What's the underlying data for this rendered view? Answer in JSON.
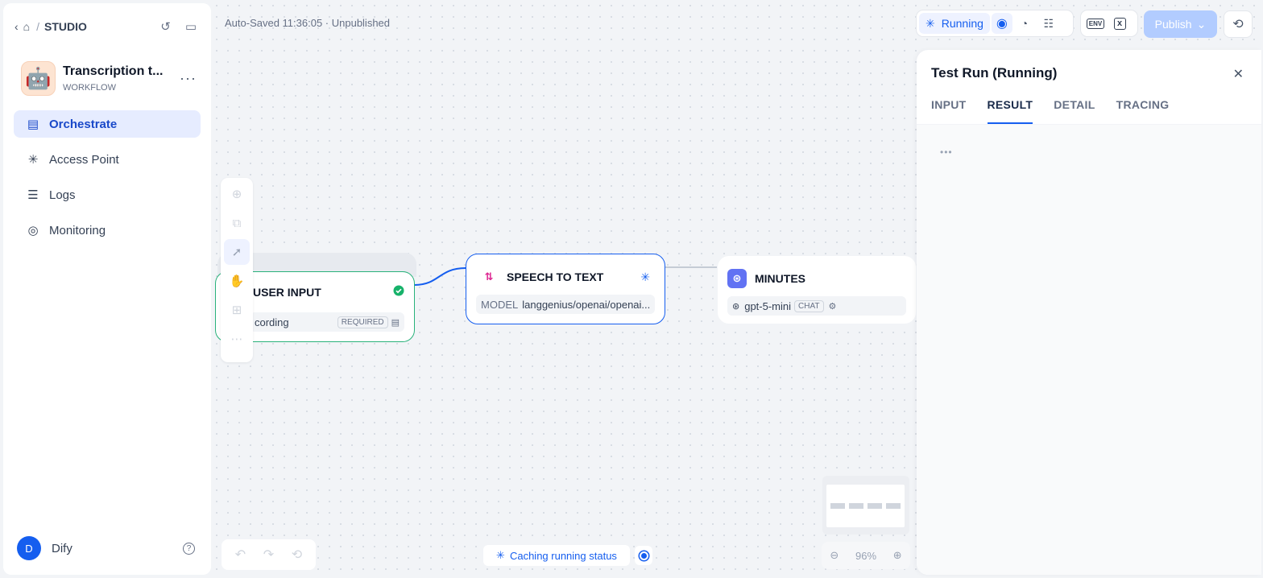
{
  "breadcrumb": {
    "studio": "STUDIO",
    "sep": "/"
  },
  "app": {
    "name": "Transcription t...",
    "type": "WORKFLOW",
    "more": "···"
  },
  "nav": [
    {
      "label": "Orchestrate",
      "icon": "orchestrate-icon"
    },
    {
      "label": "Access Point",
      "icon": "access-point-icon"
    },
    {
      "label": "Logs",
      "icon": "logs-icon"
    },
    {
      "label": "Monitoring",
      "icon": "monitoring-icon"
    }
  ],
  "user": {
    "initial": "D",
    "name": "Dify",
    "help": "?"
  },
  "header": {
    "autosave": "Auto-Saved 11:36:05 · Unpublished",
    "running_label": "Running",
    "env_label": "ENV",
    "var_label": "x",
    "publish_label": "Publish"
  },
  "nodes": {
    "input": {
      "title": "USER INPUT",
      "field": "cording",
      "tag": "REQUIRED"
    },
    "stt": {
      "title": "SPEECH TO TEXT",
      "model_label": "MODEL",
      "model_value": "langgenius/openai/openai..."
    },
    "minutes": {
      "title": "MINUTES",
      "model": "gpt-5-mini",
      "tag": "CHAT"
    }
  },
  "panel": {
    "title": "Test Run (Running)",
    "tabs": [
      "INPUT",
      "RESULT",
      "DETAIL",
      "TRACING"
    ],
    "active_tab": "RESULT",
    "loading": "•••"
  },
  "footer": {
    "cache_status": "Caching running status",
    "zoom": "96%"
  },
  "colors": {
    "accent": "#155eef",
    "success": "#2ab27b",
    "publish_disabled": "#b2ccff"
  }
}
